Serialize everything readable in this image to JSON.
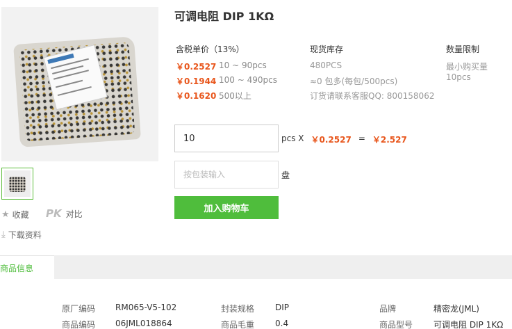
{
  "product": {
    "title": "可调电阻 DIP 1KΩ"
  },
  "actions": {
    "collect": "收藏",
    "pk": "PK",
    "compare": "对比",
    "download": "下载资料"
  },
  "pricing": {
    "header": "含税单价（13%）",
    "tiers": [
      {
        "price": "￥0.2527",
        "range": "10 ~ 90pcs"
      },
      {
        "price": "￥0.1944",
        "range": "100 ~ 490pcs"
      },
      {
        "price": "￥0.1620",
        "range": "500以上"
      }
    ]
  },
  "stock": {
    "header": "现货库存",
    "lines": [
      "480PCS",
      "≈0 包多(每包/500pcs)",
      "订货请联系客服QQ: 800158062"
    ]
  },
  "limit": {
    "header": "数量限制",
    "text": "最小购买量10pcs"
  },
  "order": {
    "quantity": "10",
    "unit": "pcs X",
    "unit_price": "￥0.2527",
    "equals": "=",
    "total": "￥2.527",
    "package_placeholder": "按包装输入",
    "package_unit": "盘",
    "add_to_cart": "加入购物车"
  },
  "tabs": {
    "info": "商品信息"
  },
  "specs": {
    "row1": [
      {
        "label": "原厂编码",
        "value": "RM065-V5-102"
      },
      {
        "label": "封装规格",
        "value": "DIP"
      },
      {
        "label": "品牌",
        "value": "精密龙(JML)"
      }
    ],
    "row2": [
      {
        "label": "商品编码",
        "value": "06JML018864"
      },
      {
        "label": "商品毛重",
        "value": "0.4"
      },
      {
        "label": "商品型号",
        "value": "可调电阻 DIP 1KΩ"
      }
    ]
  },
  "colors": {
    "accent": "#4fbd3c",
    "price": "#e8561c"
  },
  "icons": [
    "star-icon",
    "download-icon"
  ]
}
